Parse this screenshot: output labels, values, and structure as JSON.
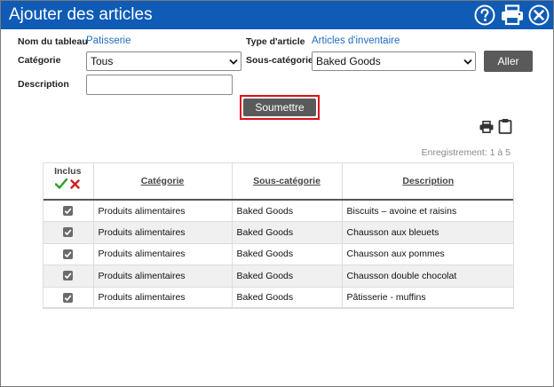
{
  "window": {
    "title": "Ajouter des articles"
  },
  "colors": {
    "titlebar": "#0f5bb5",
    "link": "#1f6cc4",
    "highlight": "#d9101b",
    "check": "#2e9d2e",
    "cross": "#d0201e"
  },
  "form": {
    "table_name_label": "Nom du tableau",
    "table_name_value": "Patisserie",
    "item_type_label": "Type d'article",
    "item_type_value": "Articles d'inventaire",
    "category_label": "Catégorie",
    "category_value": "Tous",
    "subcategory_label": "Sous-catégorie",
    "subcategory_value": "Baked Goods",
    "description_label": "Description",
    "description_value": "",
    "go_label": "Aller",
    "submit_label": "Soumettre"
  },
  "records_text": "Enregistrement: 1 à 5",
  "table": {
    "headers": {
      "included": "Inclus",
      "category": "Catégorie",
      "subcategory": "Sous-catégorie",
      "description": "Description"
    },
    "rows": [
      {
        "checked": true,
        "category": "Produits alimentaires",
        "subcategory": "Baked Goods",
        "description": "Biscuits – avoine et raisins"
      },
      {
        "checked": true,
        "category": "Produits alimentaires",
        "subcategory": "Baked Goods",
        "description": "Chausson aux bleuets"
      },
      {
        "checked": true,
        "category": "Produits alimentaires",
        "subcategory": "Baked Goods",
        "description": "Chausson aux pommes"
      },
      {
        "checked": true,
        "category": "Produits alimentaires",
        "subcategory": "Baked Goods",
        "description": "Chausson double chocolat"
      },
      {
        "checked": true,
        "category": "Produits alimentaires",
        "subcategory": "Baked Goods",
        "description": "Pâtisserie - muffins"
      }
    ]
  },
  "icons": {
    "help": "help-circle-icon",
    "print_title": "printer-icon",
    "close": "close-circle-icon",
    "print_list": "printer-icon",
    "clipboard": "clipboard-icon",
    "check_all": "checkmark-icon",
    "uncheck_all": "cross-icon",
    "dropdown": "chevron-down-icon",
    "row_check": "checkbox-checked-icon"
  }
}
